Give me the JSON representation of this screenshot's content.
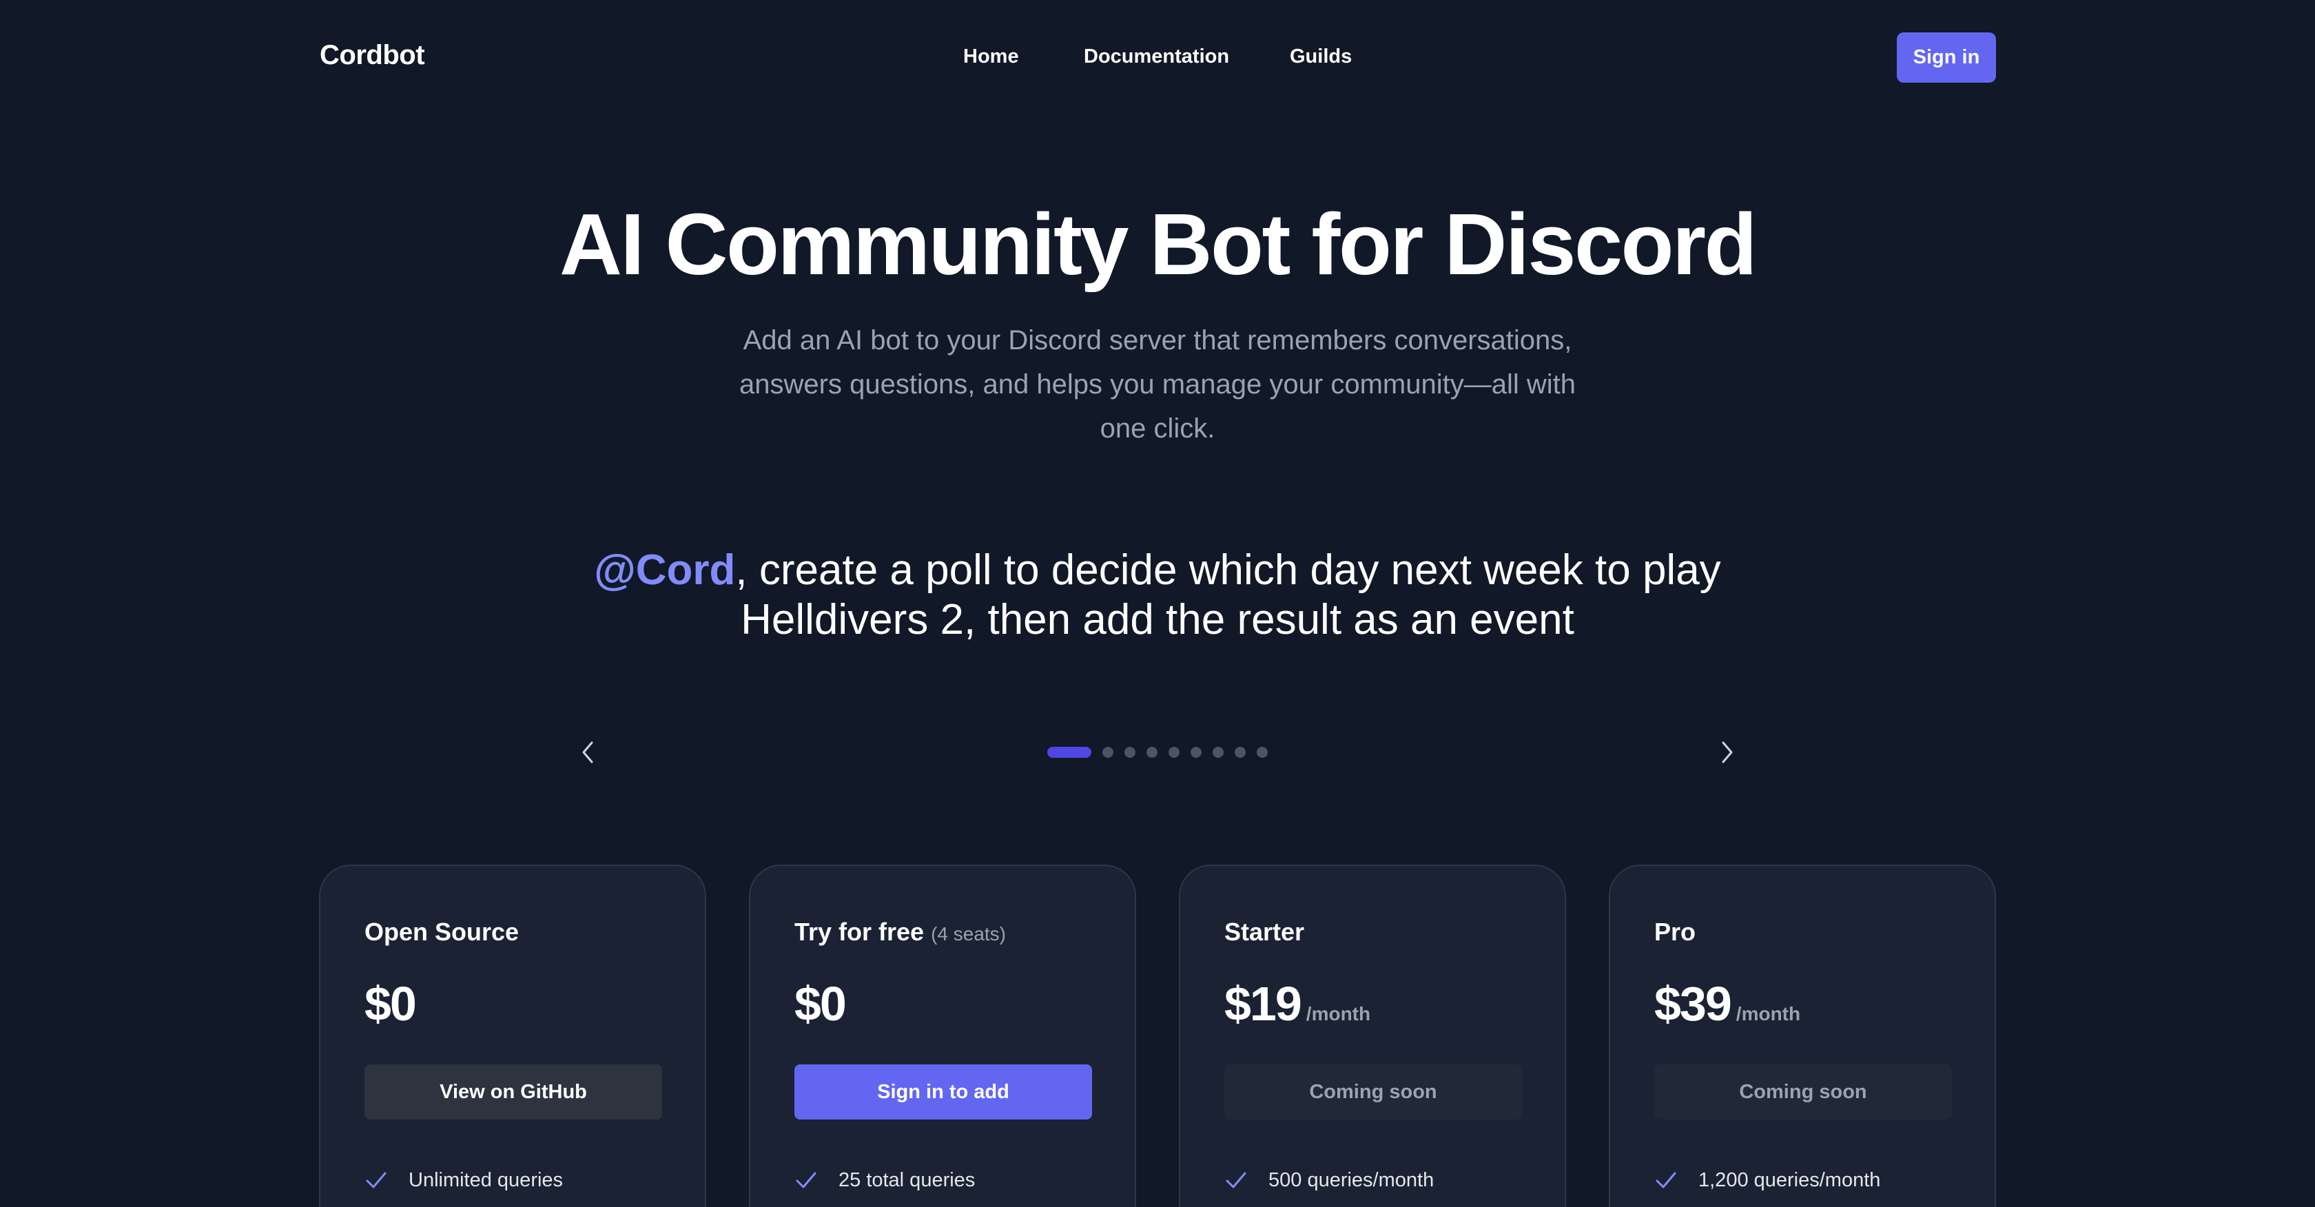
{
  "header": {
    "logo": "Cordbot",
    "nav": {
      "home": "Home",
      "documentation": "Documentation",
      "guilds": "Guilds"
    },
    "sign_in": "Sign in"
  },
  "hero": {
    "title": "AI Community Bot for Discord",
    "subtitle": "Add an AI bot to your Discord server that remembers conversations, answers questions, and helps you manage your community—all with one click."
  },
  "example_prompt": {
    "mention": "@Cord",
    "text": ", create a poll to decide which day next week to play Helldivers 2, then add the result as an event"
  },
  "carousel": {
    "slide_count": 9,
    "active_index": 0,
    "prev_icon": "chevron-left-icon",
    "next_icon": "chevron-right-icon"
  },
  "plans": [
    {
      "name": "Open Source",
      "note": "",
      "price": "$0",
      "period": "",
      "button": "View on GitHub",
      "feature": "Unlimited queries"
    },
    {
      "name": "Try for free",
      "note": "(4 seats)",
      "price": "$0",
      "period": "",
      "button": "Sign in to add",
      "feature": "25 total queries"
    },
    {
      "name": "Starter",
      "note": "",
      "price": "$19",
      "period": "/month",
      "button": "Coming soon",
      "feature": "500 queries/month"
    },
    {
      "name": "Pro",
      "note": "",
      "price": "$39",
      "period": "/month",
      "button": "Coming soon",
      "feature": "1,200 queries/month"
    }
  ],
  "colors": {
    "background": "#111827",
    "accent": "#6366f1",
    "mention": "#818cf8",
    "muted_text": "#9ca3af",
    "card_background": "#1a2233"
  }
}
